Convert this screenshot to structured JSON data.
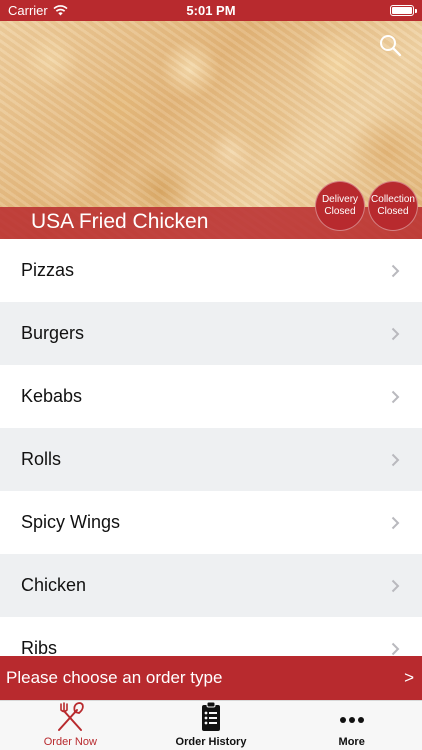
{
  "status_bar": {
    "carrier": "Carrier",
    "time": "5:01 PM"
  },
  "header": {
    "restaurant_name": "USA Fried Chicken",
    "delivery_badge": {
      "line1": "Delivery",
      "line2": "Closed"
    },
    "collection_badge": {
      "line1": "Collection",
      "line2": "Closed"
    }
  },
  "categories": [
    {
      "label": "Pizzas"
    },
    {
      "label": "Burgers"
    },
    {
      "label": "Kebabs"
    },
    {
      "label": "Rolls"
    },
    {
      "label": "Spicy Wings"
    },
    {
      "label": "Chicken"
    },
    {
      "label": "Ribs"
    }
  ],
  "order_type_bar": {
    "label": "Please choose an order type",
    "arrow": ">"
  },
  "tab_bar": {
    "tabs": [
      {
        "label": "Order Now",
        "icon": "fork-knife-icon",
        "active": true
      },
      {
        "label": "Order History",
        "icon": "clipboard-icon",
        "active": false
      },
      {
        "label": "More",
        "icon": "more-dots-icon",
        "active": false
      }
    ]
  },
  "colors": {
    "brand": "#b82a2e",
    "list_alt": "#eef0f2",
    "tab_bar_bg": "#f7f7f7"
  }
}
